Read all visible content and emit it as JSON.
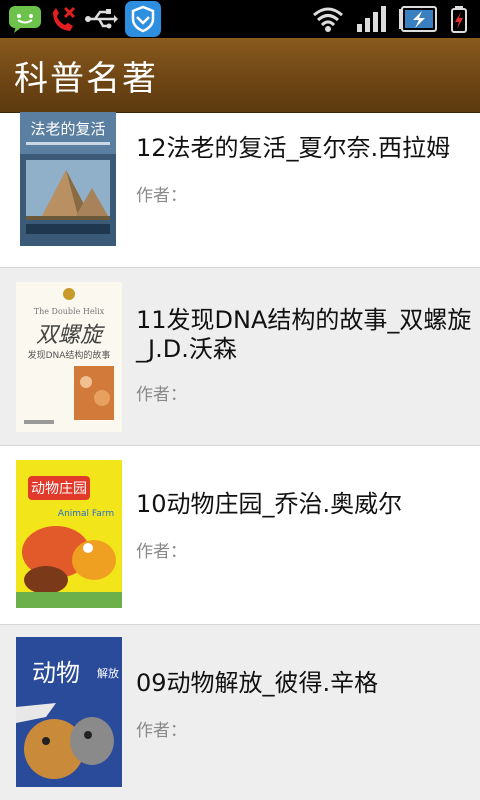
{
  "status_bar": {
    "icons": [
      "message-icon",
      "missed-call-icon",
      "usb-icon",
      "shield-app-icon",
      "wifi-icon",
      "signal-icon",
      "battery-icon",
      "charging-icon"
    ]
  },
  "header": {
    "title": "科普名著"
  },
  "books": [
    {
      "title": "12法老的复活_夏尔奈.西拉姆",
      "author_label": "作者："
    },
    {
      "title": "11发现DNA结构的故事_双螺旋_J.D.沃森",
      "author_label": "作者："
    },
    {
      "title": "10动物庄园_乔治.奥威尔",
      "author_label": "作者："
    },
    {
      "title": "09动物解放_彼得.辛格",
      "author_label": "作者："
    }
  ],
  "covers": [
    {
      "lettering": "法老的复活"
    },
    {
      "lettering": "The Double Helix 双螺旋 发现DNA结构的故事"
    },
    {
      "lettering": "动物庄园 Animal Farm"
    },
    {
      "lettering": "动物解放"
    }
  ],
  "colors": {
    "header_bg": "#6f4614",
    "alt_row_bg": "#eeeeee",
    "status_bar_bg": "#000000",
    "author_text": "#8a8a8a"
  }
}
